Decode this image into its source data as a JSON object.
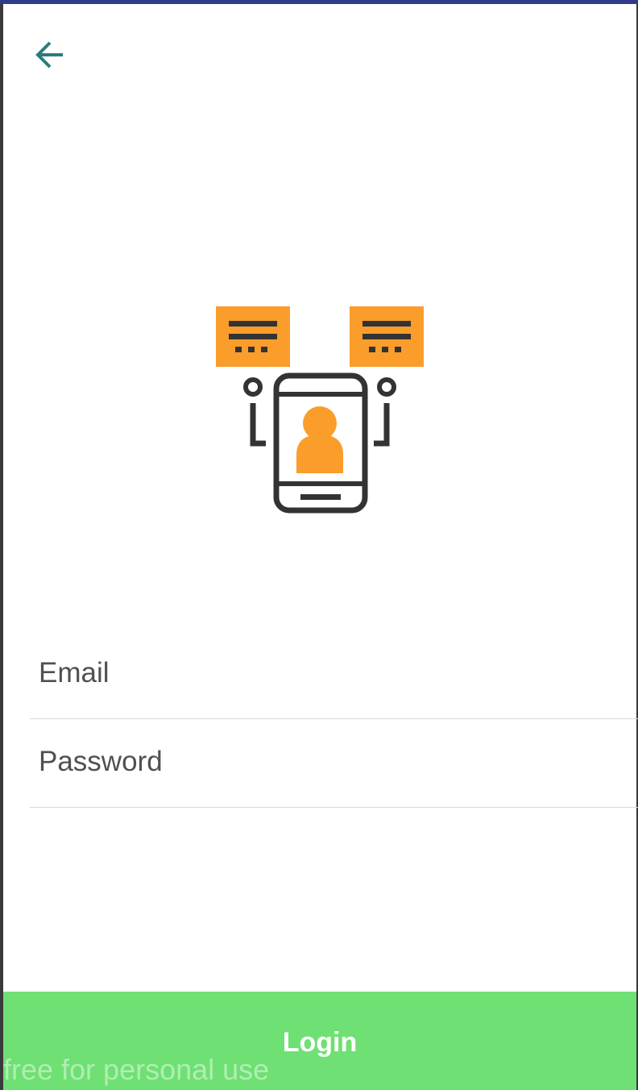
{
  "header": {
    "back_icon": "arrow-left-icon",
    "accent_color": "#2a7d7d"
  },
  "illustration": {
    "icon": "mobile-user-profile-icon",
    "primary_color": "#fa9d2b",
    "stroke_color": "#333333"
  },
  "form": {
    "email": {
      "placeholder": "Email",
      "value": ""
    },
    "password": {
      "placeholder": "Password",
      "value": ""
    }
  },
  "login_button": {
    "label": "Login",
    "color": "#6fe073"
  },
  "watermark": {
    "text": "free for personal use"
  }
}
